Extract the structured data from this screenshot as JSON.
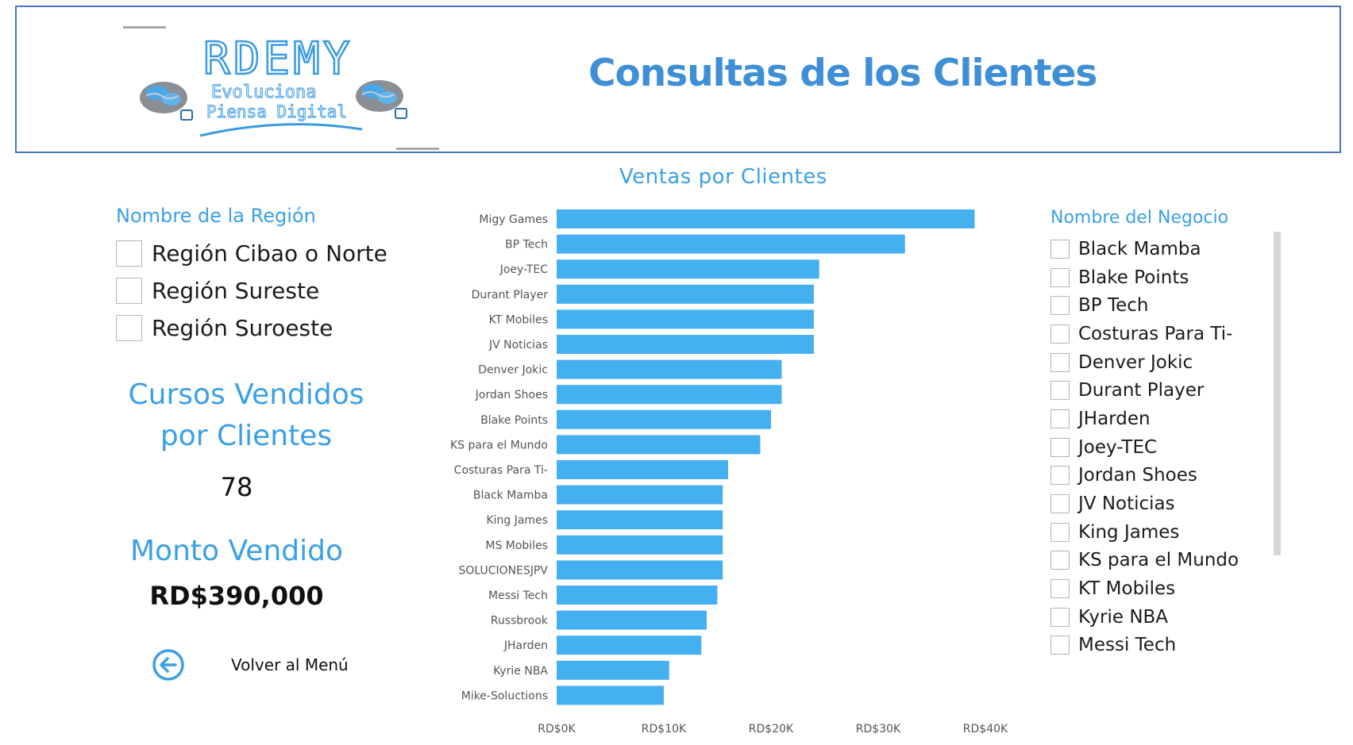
{
  "header": {
    "title": "Consultas de los Clientes",
    "logo": {
      "main_text": "RDEMY",
      "tagline_1": "Evoluciona",
      "tagline_2": "Piensa Digital"
    }
  },
  "region_slicer": {
    "title": "Nombre de la Región",
    "items": [
      {
        "label": "Región Cibao o Norte",
        "checked": false
      },
      {
        "label": "Región Sureste",
        "checked": false
      },
      {
        "label": "Región Suroeste",
        "checked": false
      }
    ]
  },
  "cards": {
    "courses_title_line1": "Cursos Vendidos",
    "courses_title_line2": "por Clientes",
    "courses_value": "78",
    "amount_title": "Monto Vendido",
    "amount_value": "RD$390,000"
  },
  "back": {
    "label": "Volver al Menú",
    "icon": "arrow-left-circle-icon"
  },
  "business_slicer": {
    "title": "Nombre del Negocio",
    "items": [
      {
        "label": "Black Mamba",
        "checked": false
      },
      {
        "label": "Blake Points",
        "checked": false
      },
      {
        "label": "BP Tech",
        "checked": false
      },
      {
        "label": "Costuras Para Ti-",
        "checked": false
      },
      {
        "label": "Denver Jokic",
        "checked": false
      },
      {
        "label": "Durant Player",
        "checked": false
      },
      {
        "label": "JHarden",
        "checked": false
      },
      {
        "label": "Joey-TEC",
        "checked": false
      },
      {
        "label": "Jordan Shoes",
        "checked": false
      },
      {
        "label": "JV Noticias",
        "checked": false
      },
      {
        "label": "King James",
        "checked": false
      },
      {
        "label": "KS para el Mundo",
        "checked": false
      },
      {
        "label": "KT Mobiles",
        "checked": false
      },
      {
        "label": "Kyrie NBA",
        "checked": false
      },
      {
        "label": "Messi Tech",
        "checked": false
      }
    ]
  },
  "colors": {
    "accent": "#3aa0e6",
    "title": "#3f8fd6",
    "bar": "#45b0f0",
    "header_border": "#4a74c4"
  },
  "chart_data": {
    "type": "bar",
    "orientation": "horizontal",
    "title": "Ventas por Clientes",
    "categories": [
      "Migy Games",
      "BP Tech",
      "Joey-TEC",
      "Durant Player",
      "KT Mobiles",
      "JV Noticias",
      "Denver Jokic",
      "Jordan Shoes",
      "Blake Points",
      "KS para el Mundo",
      "Costuras Para Ti-",
      "Black Mamba",
      "King James",
      "MS Mobiles",
      "SOLUCIONESJPV",
      "Messi Tech",
      "Russbrook",
      "JHarden",
      "Kyrie NBA",
      "Mike-Soluctions"
    ],
    "values": [
      39000,
      32500,
      24500,
      24000,
      24000,
      24000,
      21000,
      21000,
      20000,
      19000,
      16000,
      15500,
      15500,
      15500,
      15500,
      15000,
      14000,
      13500,
      10500,
      10000
    ],
    "xlim": [
      0,
      40000
    ],
    "x_ticks": [
      0,
      10000,
      20000,
      30000,
      40000
    ],
    "x_tick_labels": [
      "RD$0K",
      "RD$10K",
      "RD$20K",
      "RD$30K",
      "RD$40K"
    ],
    "xlabel": "",
    "ylabel": "",
    "grid": false,
    "legend": "none"
  }
}
